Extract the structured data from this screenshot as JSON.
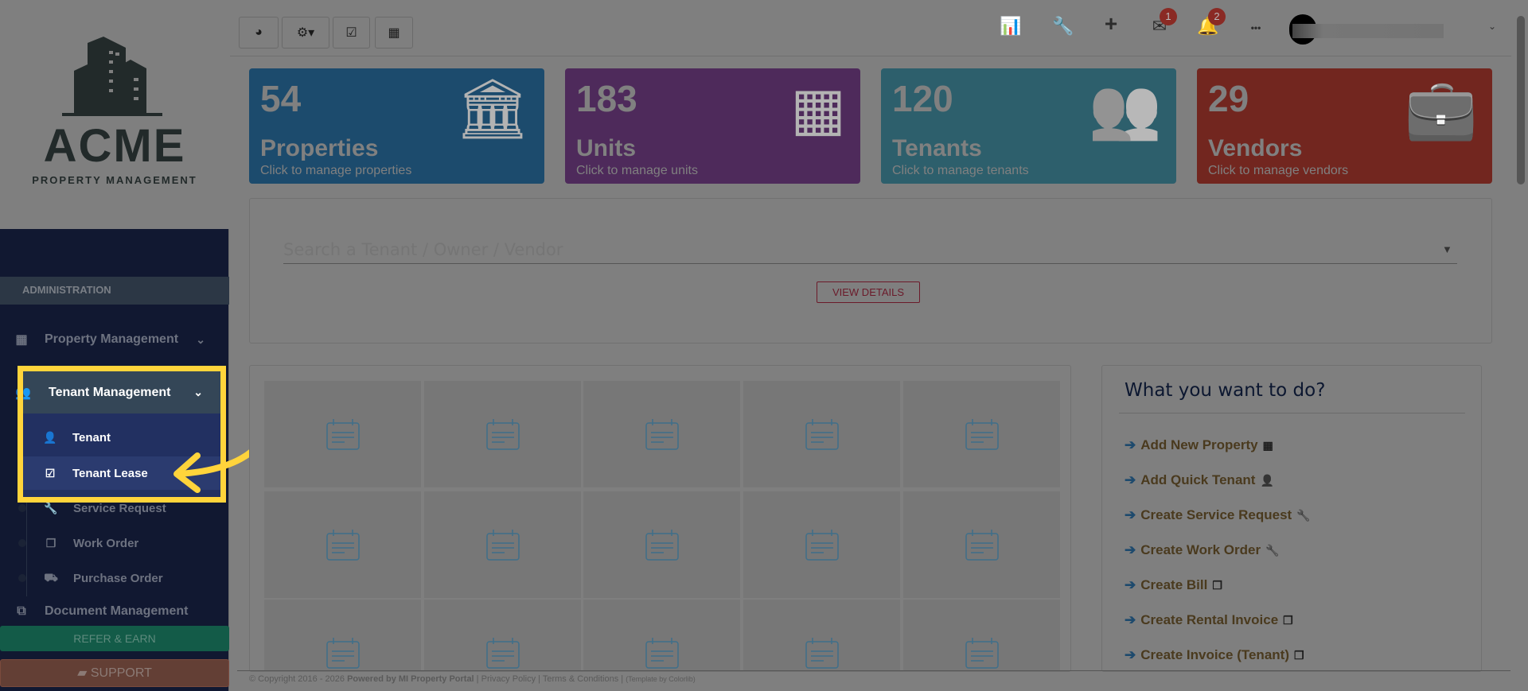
{
  "logo": {
    "name": "ACME",
    "tagline": "PROPERTY MANAGEMENT"
  },
  "sidebar": {
    "section": "ADMINISTRATION",
    "items": [
      {
        "label": "Property Management",
        "icon": "building-icon"
      },
      {
        "label": "Tenant Management",
        "icon": "users-icon"
      },
      {
        "label": "Document Management",
        "icon": "documents-icon"
      }
    ],
    "subitems": [
      {
        "label": "Tenant",
        "icon": "user-icon"
      },
      {
        "label": "Tenant Lease",
        "icon": "calendar-check-icon"
      },
      {
        "label": "Service Request",
        "icon": "wrench-icon"
      },
      {
        "label": "Work Order",
        "icon": "copy-icon"
      },
      {
        "label": "Purchase Order",
        "icon": "truck-icon"
      }
    ],
    "refer": "REFER & EARN",
    "support": "SUPPORT"
  },
  "topbar": {
    "mail_count": "1",
    "notif_count": "2",
    "more": "•••"
  },
  "cards": [
    {
      "num": "54",
      "label": "Properties",
      "desc": "Click to manage properties",
      "color": "#1c4b6d"
    },
    {
      "num": "183",
      "label": "Units",
      "desc": "Click to manage units",
      "color": "#4e2a5b"
    },
    {
      "num": "120",
      "label": "Tenants",
      "desc": "Click to manage tenants",
      "color": "#2d5f6c"
    },
    {
      "num": "29",
      "label": "Vendors",
      "desc": "Click to manage vendors",
      "color": "#72261f"
    }
  ],
  "search": {
    "placeholder": "Search a Tenant / Owner / Vendor",
    "button": "VIEW DETAILS"
  },
  "actions": {
    "title": "What you want to do?",
    "items": [
      "Add New Property",
      "Add Quick Tenant",
      "Create Service Request",
      "Create Work Order",
      "Create Bill",
      "Create Rental Invoice",
      "Create Invoice (Tenant)"
    ]
  },
  "footer": {
    "copyright": "© Copyright 2016 - 2026",
    "powered": "Powered by MI Property Portal",
    "privacy": "Privacy Policy",
    "terms": "Terms & Conditions",
    "template": "(Template by Colorlib)"
  }
}
